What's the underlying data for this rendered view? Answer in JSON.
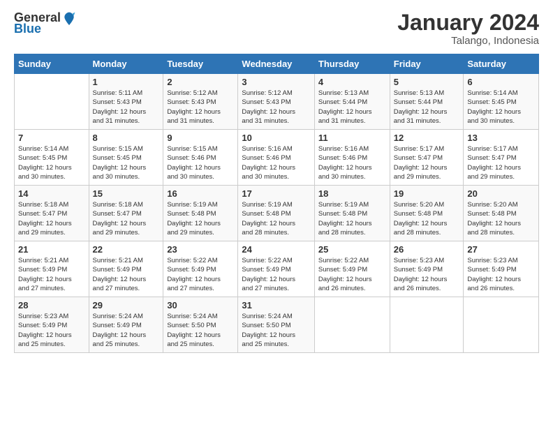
{
  "header": {
    "logo_general": "General",
    "logo_blue": "Blue",
    "month_title": "January 2024",
    "location": "Talango, Indonesia"
  },
  "days_of_week": [
    "Sunday",
    "Monday",
    "Tuesday",
    "Wednesday",
    "Thursday",
    "Friday",
    "Saturday"
  ],
  "weeks": [
    [
      {
        "day": "",
        "sunrise": "",
        "sunset": "",
        "daylight": ""
      },
      {
        "day": "1",
        "sunrise": "5:11 AM",
        "sunset": "5:43 PM",
        "daylight": "12 hours and 31 minutes."
      },
      {
        "day": "2",
        "sunrise": "5:12 AM",
        "sunset": "5:43 PM",
        "daylight": "12 hours and 31 minutes."
      },
      {
        "day": "3",
        "sunrise": "5:12 AM",
        "sunset": "5:43 PM",
        "daylight": "12 hours and 31 minutes."
      },
      {
        "day": "4",
        "sunrise": "5:13 AM",
        "sunset": "5:44 PM",
        "daylight": "12 hours and 31 minutes."
      },
      {
        "day": "5",
        "sunrise": "5:13 AM",
        "sunset": "5:44 PM",
        "daylight": "12 hours and 31 minutes."
      },
      {
        "day": "6",
        "sunrise": "5:14 AM",
        "sunset": "5:45 PM",
        "daylight": "12 hours and 30 minutes."
      }
    ],
    [
      {
        "day": "7",
        "sunrise": "5:14 AM",
        "sunset": "5:45 PM",
        "daylight": "12 hours and 30 minutes."
      },
      {
        "day": "8",
        "sunrise": "5:15 AM",
        "sunset": "5:45 PM",
        "daylight": "12 hours and 30 minutes."
      },
      {
        "day": "9",
        "sunrise": "5:15 AM",
        "sunset": "5:46 PM",
        "daylight": "12 hours and 30 minutes."
      },
      {
        "day": "10",
        "sunrise": "5:16 AM",
        "sunset": "5:46 PM",
        "daylight": "12 hours and 30 minutes."
      },
      {
        "day": "11",
        "sunrise": "5:16 AM",
        "sunset": "5:46 PM",
        "daylight": "12 hours and 30 minutes."
      },
      {
        "day": "12",
        "sunrise": "5:17 AM",
        "sunset": "5:47 PM",
        "daylight": "12 hours and 29 minutes."
      },
      {
        "day": "13",
        "sunrise": "5:17 AM",
        "sunset": "5:47 PM",
        "daylight": "12 hours and 29 minutes."
      }
    ],
    [
      {
        "day": "14",
        "sunrise": "5:18 AM",
        "sunset": "5:47 PM",
        "daylight": "12 hours and 29 minutes."
      },
      {
        "day": "15",
        "sunrise": "5:18 AM",
        "sunset": "5:47 PM",
        "daylight": "12 hours and 29 minutes."
      },
      {
        "day": "16",
        "sunrise": "5:19 AM",
        "sunset": "5:48 PM",
        "daylight": "12 hours and 29 minutes."
      },
      {
        "day": "17",
        "sunrise": "5:19 AM",
        "sunset": "5:48 PM",
        "daylight": "12 hours and 28 minutes."
      },
      {
        "day": "18",
        "sunrise": "5:19 AM",
        "sunset": "5:48 PM",
        "daylight": "12 hours and 28 minutes."
      },
      {
        "day": "19",
        "sunrise": "5:20 AM",
        "sunset": "5:48 PM",
        "daylight": "12 hours and 28 minutes."
      },
      {
        "day": "20",
        "sunrise": "5:20 AM",
        "sunset": "5:48 PM",
        "daylight": "12 hours and 28 minutes."
      }
    ],
    [
      {
        "day": "21",
        "sunrise": "5:21 AM",
        "sunset": "5:49 PM",
        "daylight": "12 hours and 27 minutes."
      },
      {
        "day": "22",
        "sunrise": "5:21 AM",
        "sunset": "5:49 PM",
        "daylight": "12 hours and 27 minutes."
      },
      {
        "day": "23",
        "sunrise": "5:22 AM",
        "sunset": "5:49 PM",
        "daylight": "12 hours and 27 minutes."
      },
      {
        "day": "24",
        "sunrise": "5:22 AM",
        "sunset": "5:49 PM",
        "daylight": "12 hours and 27 minutes."
      },
      {
        "day": "25",
        "sunrise": "5:22 AM",
        "sunset": "5:49 PM",
        "daylight": "12 hours and 26 minutes."
      },
      {
        "day": "26",
        "sunrise": "5:23 AM",
        "sunset": "5:49 PM",
        "daylight": "12 hours and 26 minutes."
      },
      {
        "day": "27",
        "sunrise": "5:23 AM",
        "sunset": "5:49 PM",
        "daylight": "12 hours and 26 minutes."
      }
    ],
    [
      {
        "day": "28",
        "sunrise": "5:23 AM",
        "sunset": "5:49 PM",
        "daylight": "12 hours and 25 minutes."
      },
      {
        "day": "29",
        "sunrise": "5:24 AM",
        "sunset": "5:49 PM",
        "daylight": "12 hours and 25 minutes."
      },
      {
        "day": "30",
        "sunrise": "5:24 AM",
        "sunset": "5:50 PM",
        "daylight": "12 hours and 25 minutes."
      },
      {
        "day": "31",
        "sunrise": "5:24 AM",
        "sunset": "5:50 PM",
        "daylight": "12 hours and 25 minutes."
      },
      {
        "day": "",
        "sunrise": "",
        "sunset": "",
        "daylight": ""
      },
      {
        "day": "",
        "sunrise": "",
        "sunset": "",
        "daylight": ""
      },
      {
        "day": "",
        "sunrise": "",
        "sunset": "",
        "daylight": ""
      }
    ]
  ]
}
